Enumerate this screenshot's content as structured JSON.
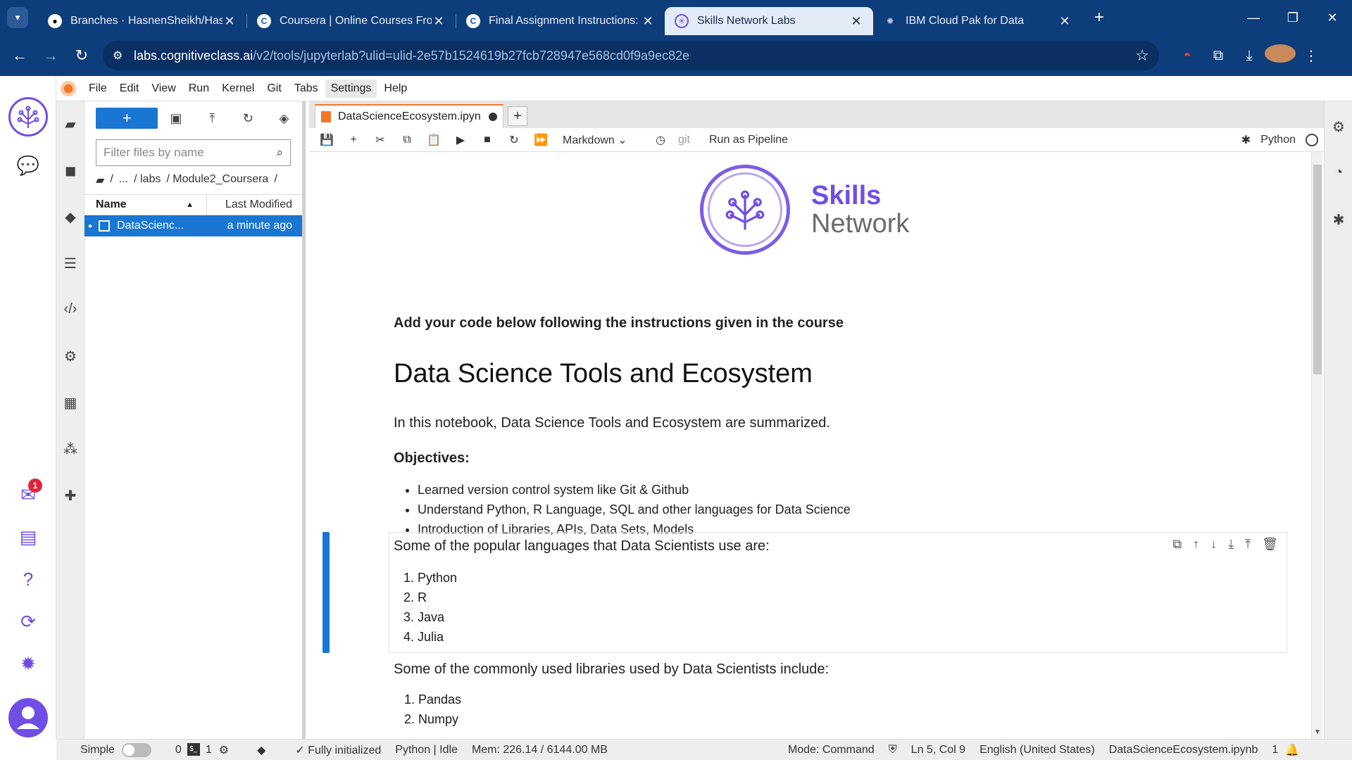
{
  "browser": {
    "tabs": [
      {
        "title": "Branches · HasnenSheikh/Hasne",
        "favicon": "github-icon"
      },
      {
        "title": "Coursera | Online Courses From",
        "favicon": "coursera-icon"
      },
      {
        "title": "Final Assignment Instructions: C",
        "favicon": "coursera-icon"
      },
      {
        "title": "Skills Network Labs",
        "favicon": "skills-network-icon",
        "active": true
      },
      {
        "title": "IBM Cloud Pak for Data",
        "favicon": "ibm-icon"
      }
    ],
    "url_host": "labs.cognitiveclass.ai",
    "url_path": "/v2/tools/jupyterlab?ulid=ulid-2e57b1524619b27fcb728947e568cd0f9a9ec82e"
  },
  "menu": [
    "File",
    "Edit",
    "View",
    "Run",
    "Kernel",
    "Git",
    "Tabs",
    "Settings",
    "Help"
  ],
  "filebrowser": {
    "filter_placeholder": "Filter files by name",
    "crumbs": [
      "/",
      "...",
      "/ labs",
      "/ Module2_Coursera",
      "/"
    ],
    "col_name": "Name",
    "col_modified": "Last Modified",
    "files": [
      {
        "name": "DataScienc...",
        "modified": "a minute ago"
      }
    ]
  },
  "notebook": {
    "tab_title": "DataScienceEcosystem.ipyn",
    "cell_type": "Markdown",
    "git_label": "git",
    "pipeline_label": "Run as Pipeline",
    "kernel_name": "Python",
    "logo_word1": "Skills",
    "logo_word2": "Network",
    "intro": "Add your code below following the instructions given in the course",
    "title": "Data Science Tools and Ecosystem",
    "lead": "In this notebook, Data Science Tools and Ecosystem are summarized.",
    "objectives_heading": "Objectives:",
    "objectives": [
      "Learned version control system like Git & Github",
      "Understand Python, R Language, SQL and other languages for Data Science",
      "Introduction of Libraries, APIs, Data Sets, Models"
    ],
    "languages_intro": "Some of the popular languages that Data Scientists use are:",
    "languages": [
      "Python",
      "R",
      "Java",
      "Julia"
    ],
    "libraries_intro": "Some of the commonly used libraries used by Data Scientists include:",
    "libraries": [
      "Pandas",
      "Numpy"
    ]
  },
  "status": {
    "mode_simple": "Simple",
    "count_a": "0",
    "count_b": "1",
    "init": "Fully initialized",
    "kernel": "Python | Idle",
    "mem": "Mem: 226.14 / 6144.00 MB",
    "mode": "Mode: Command",
    "position": "Ln 5, Col 9",
    "language": "English (United States)",
    "filename": "DataScienceEcosystem.ipynb",
    "notif_count": "1"
  },
  "sn_rail": {
    "badge_count": "1"
  }
}
